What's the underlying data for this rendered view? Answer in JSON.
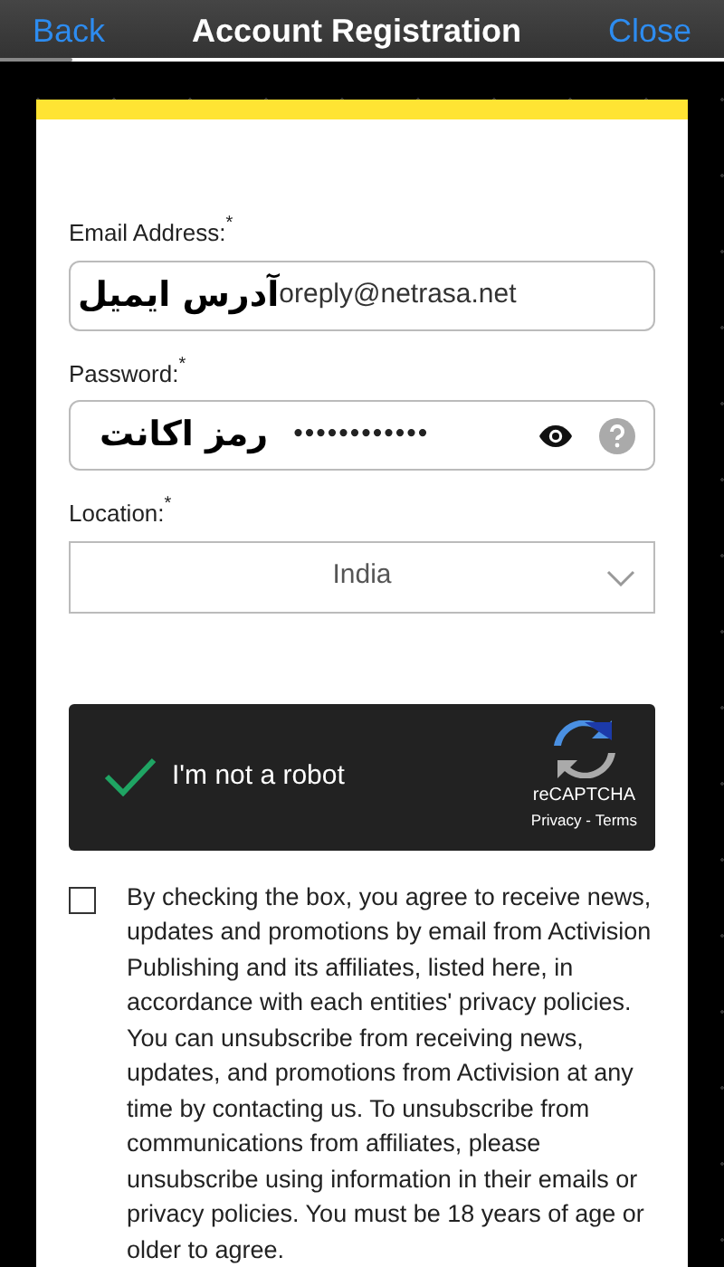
{
  "nav_bar": {
    "back": "Back",
    "title": "Account Registration",
    "close": "Close"
  },
  "progress": {
    "level": 0.1
  },
  "form": {
    "fields": [
      {
        "kind": "text",
        "label": "Email Address:",
        "required_mark": "*",
        "overlay": "آدرس ایمیل",
        "value": "oreply@netrasa.net"
      },
      {
        "kind": "password",
        "label": "Password:",
        "required_mark": "*",
        "overlay": "رمز اکانت",
        "value": "••••••••••••"
      },
      {
        "kind": "select",
        "label": "Location:",
        "required_mark": "*",
        "value": "India"
      }
    ],
    "captcha": {
      "label": "I'm not a robot",
      "checked": true,
      "brand": "reCAPTCHA",
      "links": [
        "Privacy",
        "Terms"
      ],
      "separator": " - "
    },
    "consent": {
      "checked": false,
      "text": "By checking the box, you agree to receive news, updates and promotions by email from Activision Publishing and its affiliates, listed here, in accordance with each entities' privacy policies. You can unsubscribe from receiving news, updates, and promotions from Activision at any time by contacting us. To unsubscribe from communications from affiliates, please unsubscribe using information in their emails or privacy policies. You must be 18 years of age or older to agree."
    }
  }
}
